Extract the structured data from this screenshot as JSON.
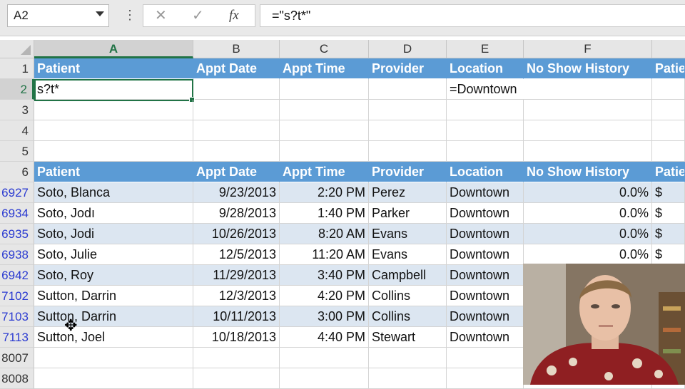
{
  "formula_bar": {
    "name_box": "A2",
    "cancel_glyph": "✕",
    "enter_glyph": "✓",
    "fx_label": "fx",
    "formula": "=\"s?t*\""
  },
  "columns": [
    "A",
    "B",
    "C",
    "D",
    "E",
    "F"
  ],
  "criteria": {
    "row_numbers": [
      "1",
      "2",
      "3",
      "4",
      "5"
    ],
    "headers": [
      "Patient",
      "Appt Date",
      "Appt Time",
      "Provider",
      "Location",
      "No Show History",
      "Patie"
    ],
    "values": [
      "s?t*",
      "",
      "",
      "",
      "=Downtown",
      "",
      ""
    ]
  },
  "table": {
    "header_row_number": "6",
    "headers": [
      "Patient",
      "Appt Date",
      "Appt Time",
      "Provider",
      "Location",
      "No Show History",
      "Patie"
    ],
    "rows": [
      {
        "row": "6927",
        "cells": [
          "Soto, Blanca",
          "9/23/2013",
          "2:20 PM",
          "Perez",
          "Downtown",
          "0.0%",
          "$"
        ]
      },
      {
        "row": "6934",
        "cells": [
          "Soto, Jodı",
          "9/28/2013",
          "1:40 PM",
          "Parker",
          "Downtown",
          "0.0%",
          "$"
        ]
      },
      {
        "row": "6935",
        "cells": [
          "Soto, Jodi",
          "10/26/2013",
          "8:20 AM",
          "Evans",
          "Downtown",
          "0.0%",
          "$"
        ]
      },
      {
        "row": "6938",
        "cells": [
          "Soto, Julie",
          "12/5/2013",
          "11:20 AM",
          "Evans",
          "Downtown",
          "0.0%",
          "$"
        ]
      },
      {
        "row": "6942",
        "cells": [
          "Soto, Roy",
          "11/29/2013",
          "3:40 PM",
          "Campbell",
          "Downtown",
          "",
          ""
        ]
      },
      {
        "row": "7102",
        "cells": [
          "Sutton, Darrin",
          "12/3/2013",
          "4:20 PM",
          "Collins",
          "Downtown",
          "",
          ""
        ]
      },
      {
        "row": "7103",
        "cells": [
          "Sutton, Darrin",
          "10/11/2013",
          "3:00 PM",
          "Collins",
          "Downtown",
          "",
          ""
        ]
      },
      {
        "row": "7113",
        "cells": [
          "Sutton, Joel",
          "10/18/2013",
          "4:40 PM",
          "Stewart",
          "Downtown",
          "",
          ""
        ]
      }
    ],
    "trailing_rows": [
      "8007",
      "8008"
    ]
  },
  "colors": {
    "header_fill": "#5b9bd5",
    "band_fill": "#dce6f1",
    "selection": "#217346",
    "filtered_row_number": "#2b3bd1"
  }
}
